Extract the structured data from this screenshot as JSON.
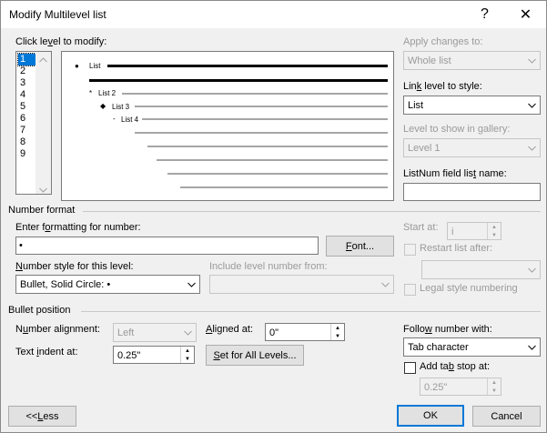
{
  "window": {
    "title": "Modify Multilevel list",
    "help_glyph": "?",
    "close_glyph": "✕"
  },
  "level_panel": {
    "label_pre": "Click le",
    "label_mn": "v",
    "label_post": "el to modify:",
    "levels": [
      "1",
      "2",
      "3",
      "4",
      "5",
      "6",
      "7",
      "8",
      "9"
    ],
    "selected": "1"
  },
  "preview": {
    "items": [
      {
        "symbol": "●",
        "text": "List"
      },
      {
        "symbol": "*",
        "text": "List 2"
      },
      {
        "symbol": "◆",
        "text": "List 3"
      },
      {
        "symbol": "-",
        "text": "List 4"
      }
    ]
  },
  "apply_changes": {
    "label": "Apply changes to:",
    "value": "Whole list"
  },
  "link_level": {
    "label_pre": "Lin",
    "label_mn": "k",
    "label_post": " level to style:",
    "value": "List"
  },
  "gallery_level": {
    "label": "Level to show in gallery:",
    "value": "Level 1"
  },
  "listnum": {
    "label_pre": "ListNum field lis",
    "label_mn": "t",
    "label_post": " name:",
    "value": ""
  },
  "number_format": {
    "section": "Number format",
    "enter_label_pre": "Enter f",
    "enter_label_mn": "o",
    "enter_label_post": "rmatting for number:",
    "format_value": "•",
    "font_button_pre": "",
    "font_button_mn": "F",
    "font_button_post": "ont...",
    "style_label_pre": "",
    "style_label_mn": "N",
    "style_label_post": "umber style for this level:",
    "style_value": "Bullet, Solid Circle: •",
    "include_label": "Include level number from:",
    "include_value": "",
    "start_label": "Start at:",
    "start_value": "i",
    "restart_label": "Restart list after:",
    "restart_value": "",
    "legal_label": "Legal style numbering"
  },
  "bullet_position": {
    "section": "Bullet position",
    "alignment_label_pre": "N",
    "alignment_label_mn": "u",
    "alignment_label_post": "mber alignment:",
    "alignment_value": "Left",
    "aligned_at_label_pre": "",
    "aligned_at_label_mn": "A",
    "aligned_at_label_post": "ligned at:",
    "aligned_at_value": "0\"",
    "indent_label_pre": "Text ",
    "indent_label_mn": "i",
    "indent_label_post": "ndent at:",
    "indent_value": "0.25\"",
    "set_all_pre": "",
    "set_all_mn": "S",
    "set_all_post": "et for All Levels...",
    "follow_label_pre": "Follo",
    "follow_label_mn": "w",
    "follow_label_post": " number with:",
    "follow_value": "Tab character",
    "tabstop_label_pre": "Add ta",
    "tabstop_label_mn": "b",
    "tabstop_label_post": " stop at:",
    "tabstop_value": "0.25\""
  },
  "buttons": {
    "less_pre": "<< ",
    "less_mn": "L",
    "less_post": "ess",
    "ok": "OK",
    "cancel": "Cancel"
  }
}
